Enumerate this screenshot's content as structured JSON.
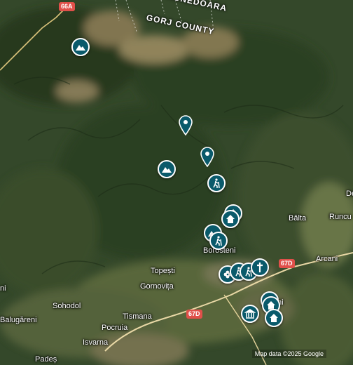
{
  "map": {
    "county_labels": [
      "GORJ COUNTY",
      "HUNEDOARA"
    ],
    "route_shields": [
      "66A",
      "67D",
      "67D"
    ],
    "places": [
      "Bălta",
      "Runcu",
      "Borostenі",
      "Topești",
      "Arcani",
      "Gornovița",
      "Sohodol",
      "Tismana",
      "Pocruia",
      "Isvarna",
      "Padeș",
      "Balugăreni",
      "ni",
      "ni",
      "De"
    ],
    "attribution": "Map data ©2025 Google"
  },
  "markers": [
    {
      "kind": "mountain-icon"
    },
    {
      "kind": "location-pin-icon"
    },
    {
      "kind": "location-pin-icon"
    },
    {
      "kind": "mountain-icon"
    },
    {
      "kind": "hiker-icon"
    },
    {
      "kind": "home-icon"
    },
    {
      "kind": "home-icon"
    },
    {
      "kind": "mountain-icon"
    },
    {
      "kind": "hiker-icon"
    },
    {
      "kind": "flower-icon"
    },
    {
      "kind": "hiker-icon"
    },
    {
      "kind": "hiker-icon"
    },
    {
      "kind": "cross-icon"
    },
    {
      "kind": "home-icon"
    },
    {
      "kind": "home-icon"
    },
    {
      "kind": "museum-icon"
    },
    {
      "kind": "home-icon"
    }
  ],
  "colors": {
    "marker": "#0a5a6b",
    "shield": "#e0504a"
  }
}
